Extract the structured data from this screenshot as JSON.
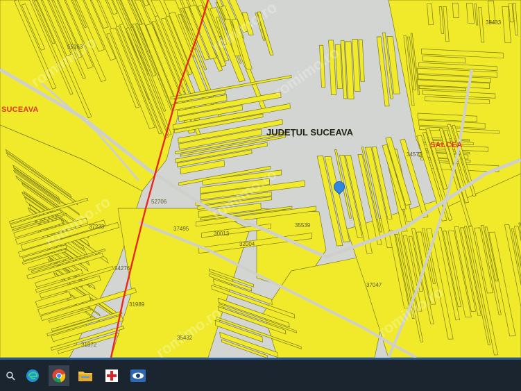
{
  "map": {
    "labels": {
      "county": "JUDEȚUL SUCEAVA",
      "city_left": "SUCEAVA",
      "city_right": "SALCEA"
    },
    "parcels": [
      "55163",
      "38433",
      "34573",
      "52706",
      "37223",
      "37495",
      "30013",
      "35539",
      "32004",
      "54276",
      "31989",
      "31872",
      "35432",
      "37047"
    ],
    "watermark": "romimo.ro",
    "colors": {
      "parcel_fill": "#f0ea2a",
      "parcel_stroke": "#7a7a1c",
      "background": "#d3d5d2",
      "boundary": "#e8281e",
      "label_red": "#e0371d",
      "pin": "#2f88e0"
    }
  },
  "taskbar": {
    "icons": [
      "search-icon",
      "edge-icon",
      "chrome-icon",
      "file-explorer-icon",
      "red-cross-app-icon",
      "eye-app-icon"
    ]
  }
}
